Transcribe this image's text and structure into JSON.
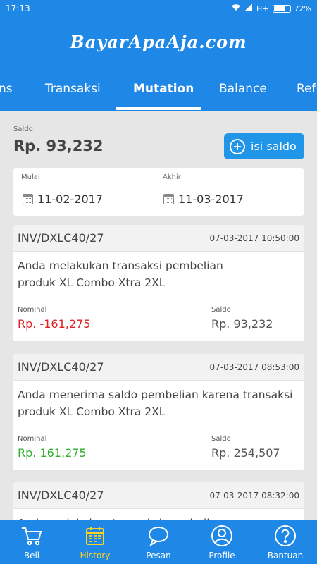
{
  "status_bar": {
    "time": "17:13",
    "network": "H+",
    "battery": "72%"
  },
  "app": {
    "title": "BayarApaAja.com"
  },
  "tabs": [
    {
      "label": "ns"
    },
    {
      "label": "Transaksi"
    },
    {
      "label": "Mutation",
      "active": true
    },
    {
      "label": "Balance"
    },
    {
      "label": "Refu"
    }
  ],
  "balance": {
    "label": "Saldo",
    "value": "Rp. 93,232",
    "topup_label": "isi saldo"
  },
  "date_range": {
    "start_label": "Mulai",
    "start_value": "11-02-2017",
    "end_label": "Akhir",
    "end_value": "11-03-2017"
  },
  "transactions": [
    {
      "invoice": "INV/DXLC40/27",
      "datetime": "07-03-2017 10:50:00",
      "desc_line1": "Anda melakukan transaksi pembelian",
      "desc_line2": "produk XL Combo Xtra 2XL",
      "nominal_label": "Nominal",
      "nominal": "Rp. -161,275",
      "nominal_color": "#e02020",
      "saldo_label": "Saldo",
      "saldo": "Rp. 93,232"
    },
    {
      "invoice": "INV/DXLC40/27",
      "datetime": "07-03-2017 08:53:00",
      "desc_line1": "Anda menerima saldo pembelian karena transaksi",
      "desc_line2": "produk XL Combo Xtra 2XL",
      "nominal_label": "Nominal",
      "nominal": "Rp. 161,275",
      "nominal_color": "#2ab02a",
      "saldo_label": "Saldo",
      "saldo": "Rp. 254,507"
    },
    {
      "invoice": "INV/DXLC40/27",
      "datetime": "07-03-2017 08:32:00",
      "desc_line1": "Anda melakukan transaksi pembelian"
    }
  ],
  "bottom_nav": [
    {
      "label": "Beli",
      "icon": "cart-icon"
    },
    {
      "label": "History",
      "icon": "calendar-icon",
      "active": true
    },
    {
      "label": "Pesan",
      "icon": "chat-icon"
    },
    {
      "label": "Profile",
      "icon": "user-icon"
    },
    {
      "label": "Bantuan",
      "icon": "help-icon"
    }
  ],
  "colors": {
    "primary": "#1f87e5",
    "accent": "#ffd21f",
    "negative": "#e02020",
    "positive": "#2ab02a"
  }
}
